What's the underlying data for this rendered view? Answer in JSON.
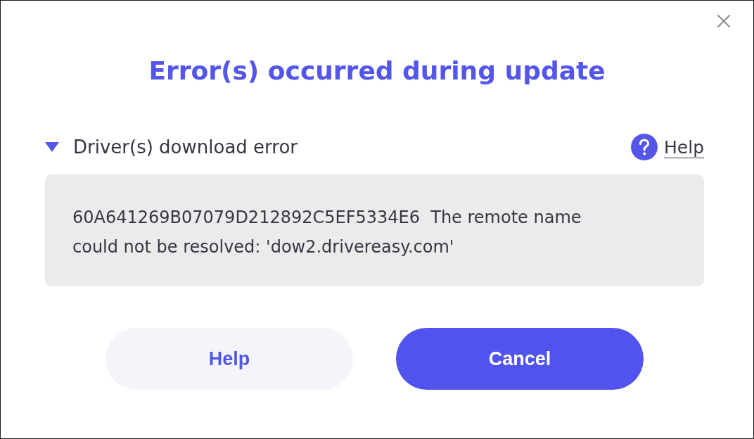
{
  "dialog": {
    "title": "Error(s) occurred during update",
    "section": {
      "label": "Driver(s) download error",
      "expanded": true,
      "help_link": "Help",
      "message": "60A641269B07079D212892C5EF5334E6  The remote name could not be resolved: 'dow2.drivereasy.com'"
    },
    "buttons": [
      {
        "label": "Help",
        "kind": "secondary"
      },
      {
        "label": "Cancel",
        "kind": "primary"
      }
    ]
  }
}
